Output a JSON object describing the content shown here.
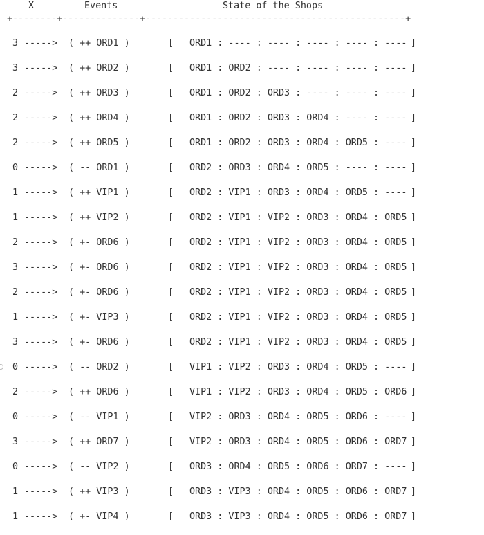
{
  "header": {
    "x_label": "X",
    "events_label": "Events",
    "state_label": "State of the Shops",
    "border": "+--------+--------------+-----------------------------------------------+"
  },
  "rows": [
    {
      "x": "3",
      "arrow": "----->",
      "event": "( ++ ORD1 )",
      "open": "[",
      "state": "ORD1 : ---- : ---- : ---- : ---- : ----",
      "close": "]"
    },
    {
      "x": "3",
      "arrow": "----->",
      "event": "( ++ ORD2 )",
      "open": "[",
      "state": "ORD1 : ORD2 : ---- : ---- : ---- : ----",
      "close": "]"
    },
    {
      "x": "2",
      "arrow": "----->",
      "event": "( ++ ORD3 )",
      "open": "[",
      "state": "ORD1 : ORD2 : ORD3 : ---- : ---- : ----",
      "close": "]"
    },
    {
      "x": "2",
      "arrow": "----->",
      "event": "( ++ ORD4 )",
      "open": "[",
      "state": "ORD1 : ORD2 : ORD3 : ORD4 : ---- : ----",
      "close": "]"
    },
    {
      "x": "2",
      "arrow": "----->",
      "event": "( ++ ORD5 )",
      "open": "[",
      "state": "ORD1 : ORD2 : ORD3 : ORD4 : ORD5 : ----",
      "close": "]"
    },
    {
      "x": "0",
      "arrow": "----->",
      "event": "( -- ORD1 )",
      "open": "[",
      "state": "ORD2 : ORD3 : ORD4 : ORD5 : ---- : ----",
      "close": "]"
    },
    {
      "x": "1",
      "arrow": "----->",
      "event": "( ++ VIP1 )",
      "open": "[",
      "state": "ORD2 : VIP1 : ORD3 : ORD4 : ORD5 : ----",
      "close": "]"
    },
    {
      "x": "1",
      "arrow": "----->",
      "event": "( ++ VIP2 )",
      "open": "[",
      "state": "ORD2 : VIP1 : VIP2 : ORD3 : ORD4 : ORD5",
      "close": "]"
    },
    {
      "x": "2",
      "arrow": "----->",
      "event": "( +- ORD6 )",
      "open": "[",
      "state": "ORD2 : VIP1 : VIP2 : ORD3 : ORD4 : ORD5",
      "close": "]"
    },
    {
      "x": "3",
      "arrow": "----->",
      "event": "( +- ORD6 )",
      "open": "[",
      "state": "ORD2 : VIP1 : VIP2 : ORD3 : ORD4 : ORD5",
      "close": "]"
    },
    {
      "x": "2",
      "arrow": "----->",
      "event": "( +- ORD6 )",
      "open": "[",
      "state": "ORD2 : VIP1 : VIP2 : ORD3 : ORD4 : ORD5",
      "close": "]"
    },
    {
      "x": "1",
      "arrow": "----->",
      "event": "( +- VIP3 )",
      "open": "[",
      "state": "ORD2 : VIP1 : VIP2 : ORD3 : ORD4 : ORD5",
      "close": "]"
    },
    {
      "x": "3",
      "arrow": "----->",
      "event": "( +- ORD6 )",
      "open": "[",
      "state": "ORD2 : VIP1 : VIP2 : ORD3 : ORD4 : ORD5",
      "close": "]"
    },
    {
      "x": "0",
      "arrow": "----->",
      "event": "( -- ORD2 )",
      "open": "[",
      "state": "VIP1 : VIP2 : ORD3 : ORD4 : ORD5 : ----",
      "close": "]"
    },
    {
      "x": "2",
      "arrow": "----->",
      "event": "( ++ ORD6 )",
      "open": "[",
      "state": "VIP1 : VIP2 : ORD3 : ORD4 : ORD5 : ORD6",
      "close": "]"
    },
    {
      "x": "0",
      "arrow": "----->",
      "event": "( -- VIP1 )",
      "open": "[",
      "state": "VIP2 : ORD3 : ORD4 : ORD5 : ORD6 : ----",
      "close": "]"
    },
    {
      "x": "3",
      "arrow": "----->",
      "event": "( ++ ORD7 )",
      "open": "[",
      "state": "VIP2 : ORD3 : ORD4 : ORD5 : ORD6 : ORD7",
      "close": "]"
    },
    {
      "x": "0",
      "arrow": "----->",
      "event": "( -- VIP2 )",
      "open": "[",
      "state": "ORD3 : ORD4 : ORD5 : ORD6 : ORD7 : ----",
      "close": "]"
    },
    {
      "x": "1",
      "arrow": "----->",
      "event": "( ++ VIP3 )",
      "open": "[",
      "state": "ORD3 : VIP3 : ORD4 : ORD5 : ORD6 : ORD7",
      "close": "]"
    },
    {
      "x": "1",
      "arrow": "----->",
      "event": "( +- VIP4 )",
      "open": "[",
      "state": "ORD3 : VIP3 : ORD4 : ORD5 : ORD6 : ORD7",
      "close": "]"
    }
  ]
}
